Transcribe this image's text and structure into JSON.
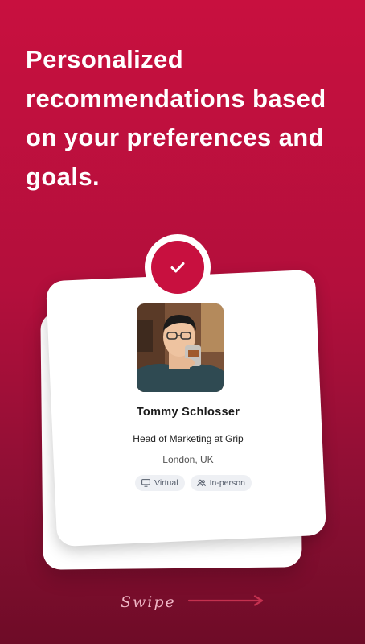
{
  "headline": "Personalized recommendations based on your preferences and goals.",
  "profile": {
    "name": "Tommy Schlosser",
    "title": "Head of Marketing at Grip",
    "location": "London, UK",
    "tags": [
      {
        "label": "Virtual",
        "icon": "monitor-icon"
      },
      {
        "label": "In-person",
        "icon": "people-icon"
      }
    ],
    "avatar_alt": "Tommy Schlosser"
  },
  "swipe": {
    "label": "Swipe",
    "icon": "arrow-right-icon"
  },
  "colors": {
    "brand": "#c8103f",
    "background_dark": "#6e0c27",
    "tag_bg": "#eef0f4"
  }
}
